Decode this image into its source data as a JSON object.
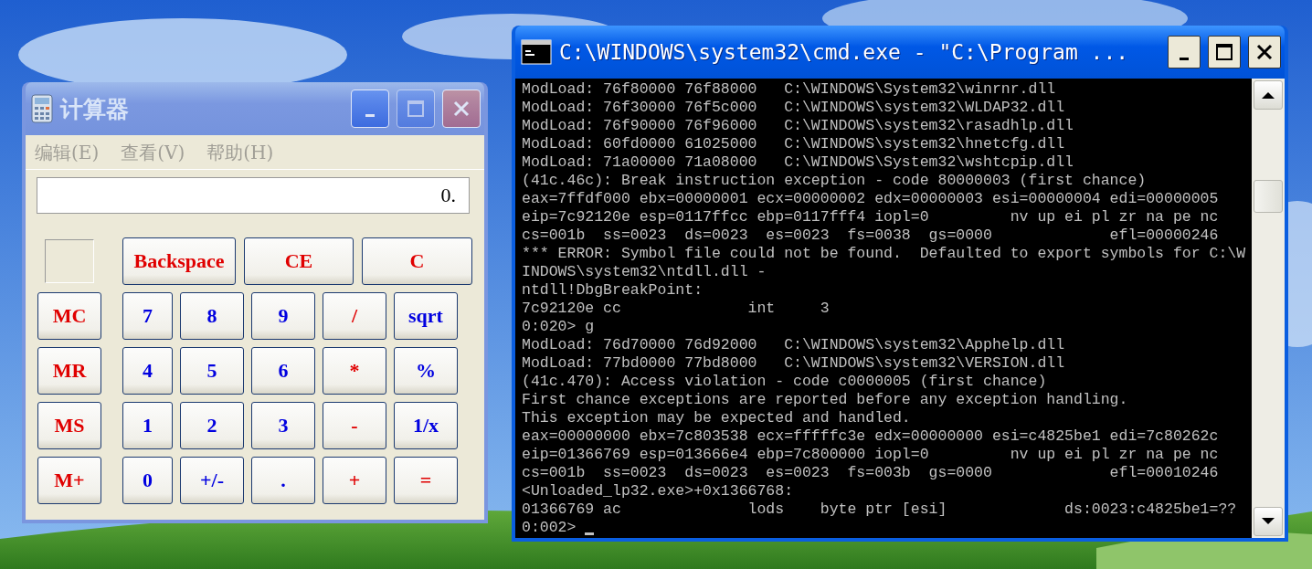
{
  "calculator": {
    "title": "计算器",
    "active": false,
    "maximize_disabled": true,
    "menu": [
      {
        "label": "编辑(E)"
      },
      {
        "label": "查看(V)"
      },
      {
        "label": "帮助(H)"
      }
    ],
    "display": "0.",
    "top_keys": [
      {
        "label": "Backspace",
        "color": "#e00000"
      },
      {
        "label": "CE",
        "color": "#e00000"
      },
      {
        "label": "C",
        "color": "#e00000"
      }
    ],
    "memory_keys": [
      {
        "label": "MC",
        "color": "#e00000"
      },
      {
        "label": "MR",
        "color": "#e00000"
      },
      {
        "label": "MS",
        "color": "#e00000"
      },
      {
        "label": "M+",
        "color": "#e00000"
      }
    ],
    "keys": [
      {
        "label": "7",
        "color": "#0000e0"
      },
      {
        "label": "8",
        "color": "#0000e0"
      },
      {
        "label": "9",
        "color": "#0000e0"
      },
      {
        "label": "/",
        "color": "#e00000"
      },
      {
        "label": "sqrt",
        "color": "#0000e0"
      },
      {
        "label": "4",
        "color": "#0000e0"
      },
      {
        "label": "5",
        "color": "#0000e0"
      },
      {
        "label": "6",
        "color": "#0000e0"
      },
      {
        "label": "*",
        "color": "#e00000"
      },
      {
        "label": "%",
        "color": "#0000e0"
      },
      {
        "label": "1",
        "color": "#0000e0"
      },
      {
        "label": "2",
        "color": "#0000e0"
      },
      {
        "label": "3",
        "color": "#0000e0"
      },
      {
        "label": "-",
        "color": "#e00000"
      },
      {
        "label": "1/x",
        "color": "#0000e0"
      },
      {
        "label": "0",
        "color": "#0000e0"
      },
      {
        "label": "+/-",
        "color": "#0000e0"
      },
      {
        "label": ".",
        "color": "#0000e0"
      },
      {
        "label": "+",
        "color": "#e00000"
      },
      {
        "label": "=",
        "color": "#e00000"
      }
    ]
  },
  "console": {
    "title": "C:\\WINDOWS\\system32\\cmd.exe - \"C:\\Program ...",
    "active": true,
    "lines": [
      "ModLoad: 76f80000 76f88000   C:\\WINDOWS\\System32\\winrnr.dll",
      "ModLoad: 76f30000 76f5c000   C:\\WINDOWS\\system32\\WLDAP32.dll",
      "ModLoad: 76f90000 76f96000   C:\\WINDOWS\\system32\\rasadhlp.dll",
      "ModLoad: 60fd0000 61025000   C:\\WINDOWS\\system32\\hnetcfg.dll",
      "ModLoad: 71a00000 71a08000   C:\\WINDOWS\\System32\\wshtcpip.dll",
      "(41c.46c): Break instruction exception - code 80000003 (first chance)",
      "eax=7ffdf000 ebx=00000001 ecx=00000002 edx=00000003 esi=00000004 edi=00000005",
      "eip=7c92120e esp=0117ffcc ebp=0117fff4 iopl=0         nv up ei pl zr na pe nc",
      "cs=001b  ss=0023  ds=0023  es=0023  fs=0038  gs=0000             efl=00000246",
      "*** ERROR: Symbol file could not be found.  Defaulted to export symbols for C:\\W",
      "INDOWS\\system32\\ntdll.dll -",
      "ntdll!DbgBreakPoint:",
      "7c92120e cc              int     3",
      "0:020> g",
      "ModLoad: 76d70000 76d92000   C:\\WINDOWS\\system32\\Apphelp.dll",
      "ModLoad: 77bd0000 77bd8000   C:\\WINDOWS\\system32\\VERSION.dll",
      "(41c.470): Access violation - code c0000005 (first chance)",
      "First chance exceptions are reported before any exception handling.",
      "This exception may be expected and handled.",
      "eax=00000000 ebx=7c803538 ecx=fffffc3e edx=00000000 esi=c4825be1 edi=7c80262c",
      "eip=01366769 esp=013666e4 ebp=7c800000 iopl=0         nv up ei pl zr na pe nc",
      "cs=001b  ss=0023  ds=0023  es=0023  fs=003b  gs=0000             efl=00010246",
      "<Unloaded_lp32.exe>+0x1366768:",
      "01366769 ac              lods    byte ptr [esi]             ds:0023:c4825be1=??",
      "0:002>"
    ]
  }
}
